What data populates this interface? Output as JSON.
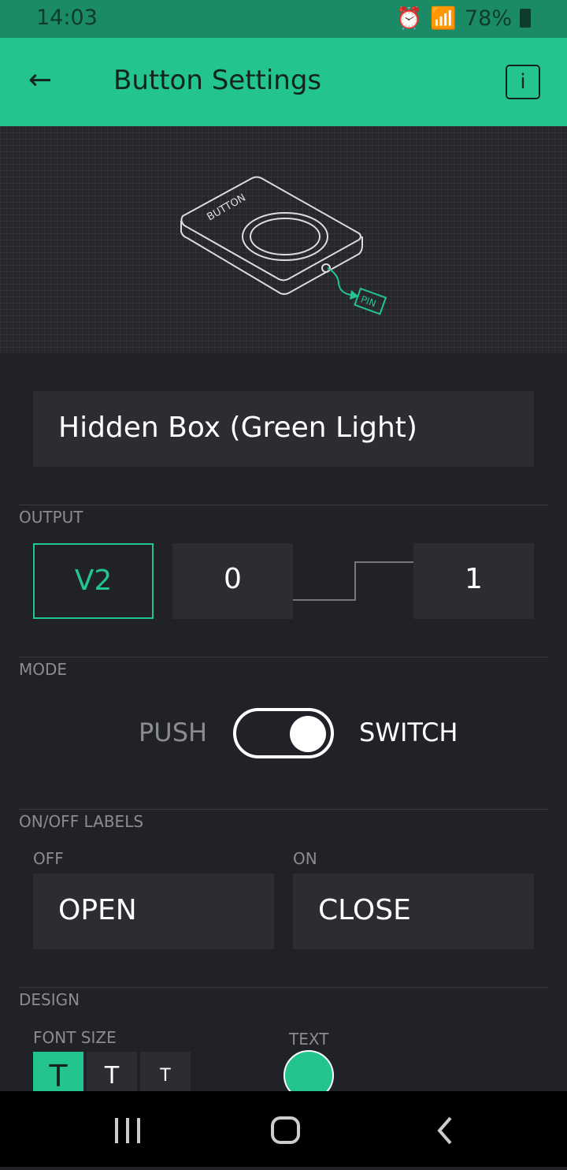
{
  "status_bar": {
    "time": "14:03",
    "battery": "78%"
  },
  "header": {
    "title": "Button Settings",
    "back_icon": "arrow-left-icon",
    "info_label": "i"
  },
  "hero": {
    "button_label": "BUTTON",
    "pin_label": "PIN",
    "accent": "#23c48e"
  },
  "name_field": {
    "value": "Hidden Box (Green Light)"
  },
  "output": {
    "section": "OUTPUT",
    "pin": "V2",
    "low": "0",
    "high": "1"
  },
  "mode": {
    "section": "MODE",
    "left": "PUSH",
    "right": "SWITCH",
    "switch_on": true
  },
  "labels": {
    "section": "ON/OFF LABELS",
    "off_label": "OFF",
    "on_label": "ON",
    "off_value": "OPEN",
    "on_value": "CLOSE"
  },
  "design": {
    "section": "DESIGN",
    "font_size_label": "FONT SIZE",
    "text_label": "TEXT",
    "sizes": [
      "T",
      "T",
      "T"
    ],
    "text_color": "#23c48e"
  }
}
